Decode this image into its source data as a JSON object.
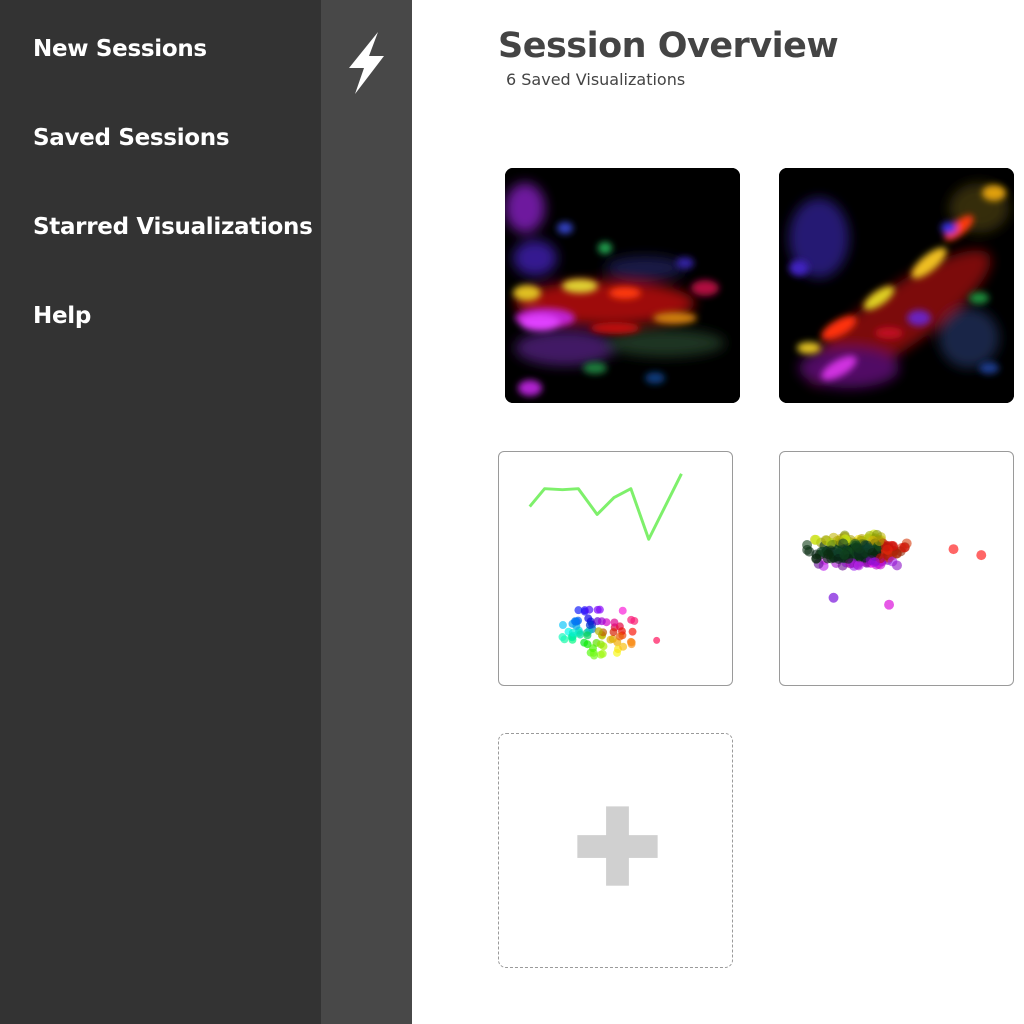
{
  "sidebar": {
    "items": [
      {
        "label": "New Sessions"
      },
      {
        "label": "Saved Sessions"
      },
      {
        "label": "Starred Visualizations"
      },
      {
        "label": "Help"
      }
    ]
  },
  "rail": {
    "icon": "lightning-bolt-icon"
  },
  "main": {
    "title": "Session Overview",
    "subtitle": "6 Saved Visualizations",
    "cards": [
      {
        "kind": "image",
        "icon": "heatmap-thumbnail"
      },
      {
        "kind": "image",
        "icon": "heatmap-thumbnail"
      },
      {
        "kind": "plot",
        "icon": "line-and-scatter-thumbnail"
      },
      {
        "kind": "plot",
        "icon": "scatter-thumbnail"
      },
      {
        "kind": "add",
        "icon": "plus-icon"
      }
    ]
  },
  "colors": {
    "sidebar_bg": "#333333",
    "rail_bg": "#484848",
    "title_text": "#444444",
    "line_green": "#7ef06b",
    "plus_gray": "#d0d0d0"
  }
}
